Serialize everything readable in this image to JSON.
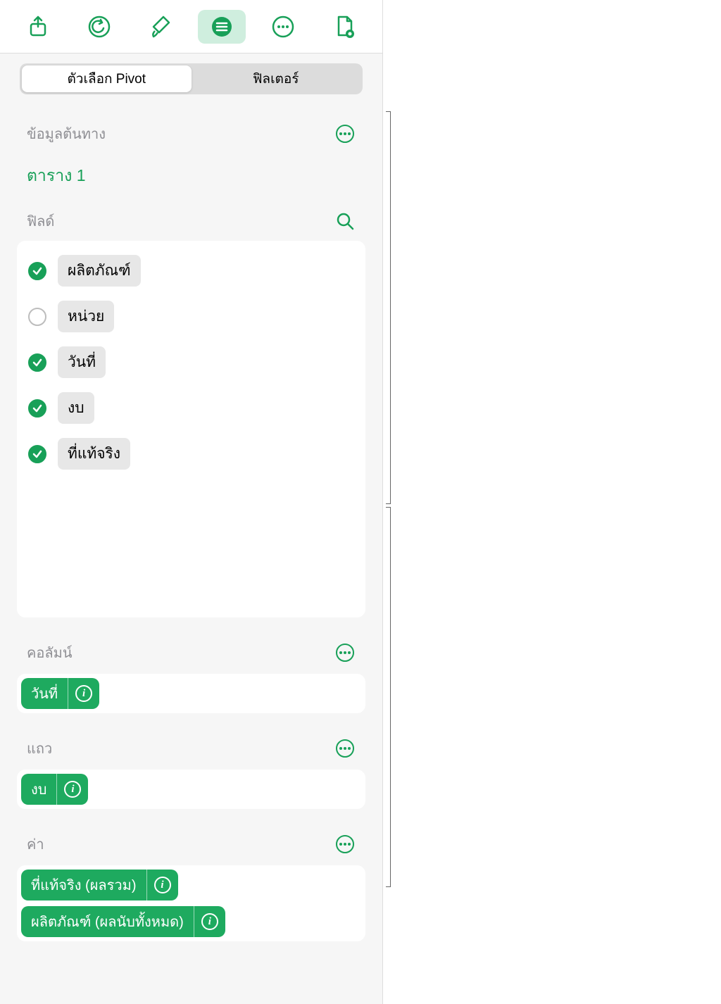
{
  "tabs": {
    "pivot": "ตัวเลือก Pivot",
    "filter": "ฟิลเตอร์"
  },
  "source": {
    "label": "ข้อมูลต้นทาง",
    "name": "ตาราง 1"
  },
  "fields": {
    "label": "ฟิลด์",
    "items": [
      {
        "label": "ผลิตภัณฑ์",
        "checked": true
      },
      {
        "label": "หน่วย",
        "checked": false
      },
      {
        "label": "วันที่",
        "checked": true
      },
      {
        "label": "งบ",
        "checked": true
      },
      {
        "label": "ที่แท้จริง",
        "checked": true
      }
    ]
  },
  "columns": {
    "label": "คอลัมน์",
    "items": [
      {
        "label": "วันที่"
      }
    ]
  },
  "rows": {
    "label": "แถว",
    "items": [
      {
        "label": "งบ"
      }
    ]
  },
  "values": {
    "label": "ค่า",
    "items": [
      {
        "label": "ที่แท้จริง (ผลรวม)"
      },
      {
        "label": "ผลิตภัณฑ์ (ผลนับทั้งหมด)"
      }
    ]
  }
}
